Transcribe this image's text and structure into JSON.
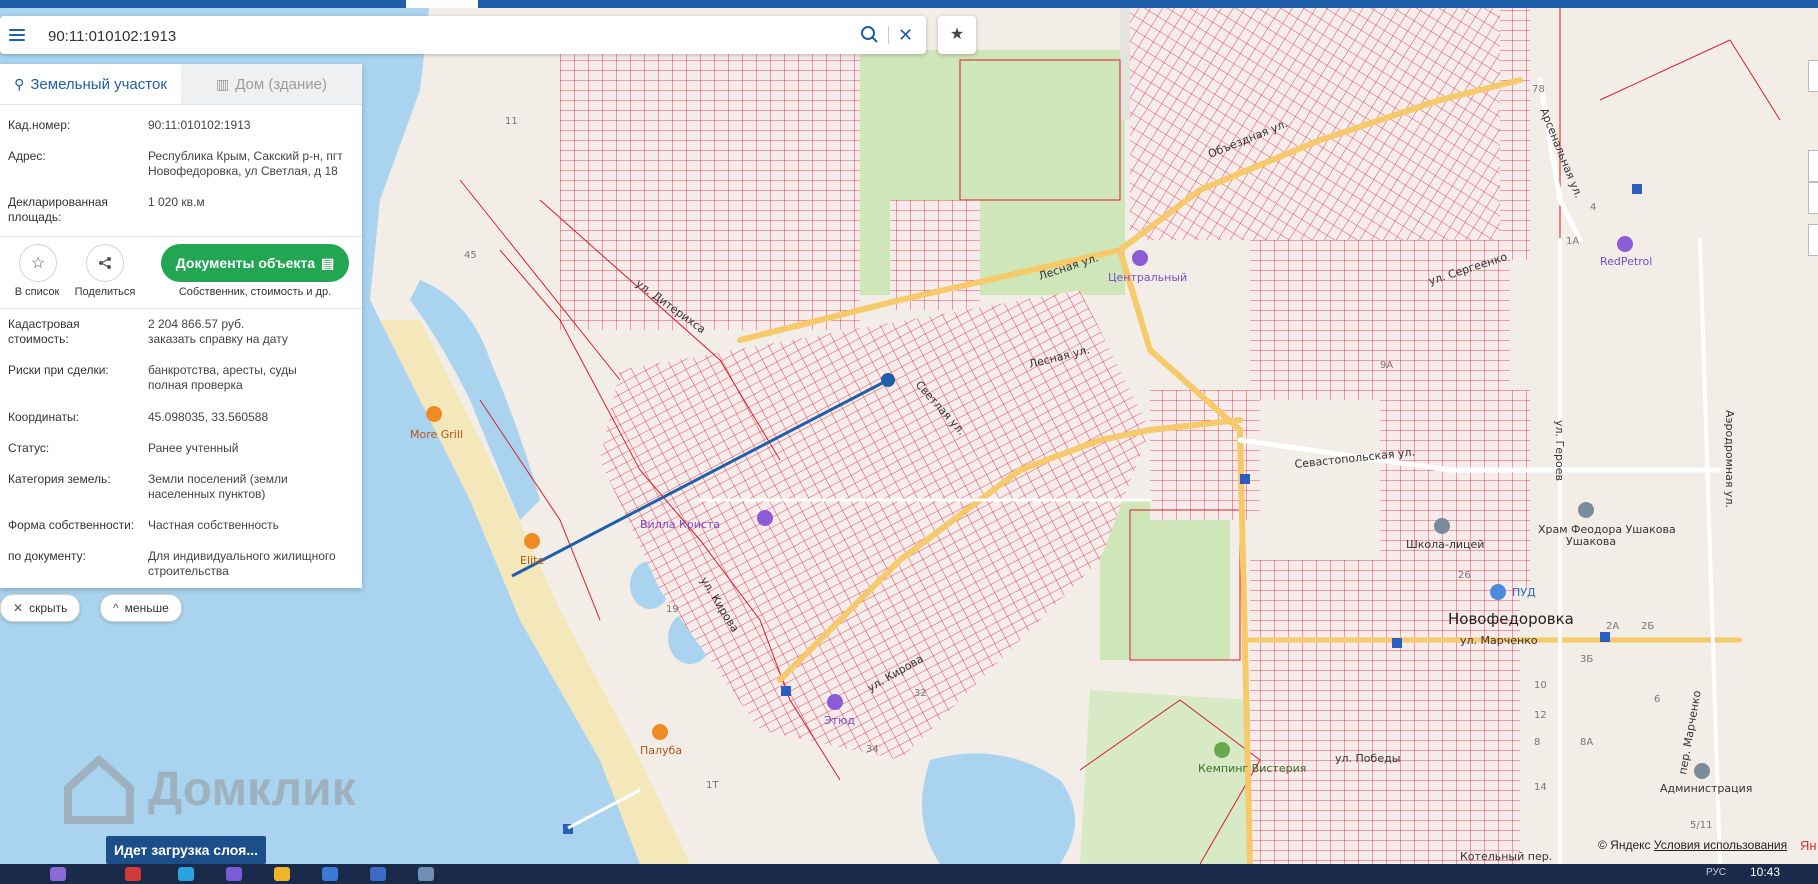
{
  "search": {
    "value": "90:11:010102:1913"
  },
  "tabs": [
    {
      "label": "Земельный участок",
      "icon": "map-pin-icon",
      "active": true
    },
    {
      "label": "Дом (здание)",
      "icon": "building-icon",
      "active": false
    }
  ],
  "details": {
    "cadastral_label": "Кад.номер:",
    "cadastral_value": "90:11:010102:1913",
    "address_label": "Адрес:",
    "address_value": "Республика Крым, Сакский р-н, пгт Новофедоровка, ул Светлая, д 18",
    "area_label": "Декларированная площадь:",
    "area_value": "1 020 кв.м"
  },
  "actions": {
    "list_label": "В список",
    "share_label": "Поделиться",
    "docs_label": "Документы объекта",
    "docs_sub": "Собственник, стоимость и др."
  },
  "info": {
    "cost_label": "Кадастровая стоимость:",
    "cost_value": "2 204 866.57 руб.",
    "cost_link": "заказать справку на дату",
    "risks_label": "Риски при сделки:",
    "risks_value": "банкротства, аресты, суды",
    "risks_link": "полная проверка",
    "coords_label": "Координаты:",
    "coords_value": "45.098035, 33.560588",
    "status_label": "Статус:",
    "status_value": "Ранее учтенный",
    "category_label": "Категория земель:",
    "category_value": "Земли поселений (земли населенных пунктов)",
    "ownership_label": "Форма собственности:",
    "ownership_value": "Частная собственность",
    "doc_label": "по документу:",
    "doc_value": "Для индивидуального жилищного строительства"
  },
  "controls": {
    "hide_label": "скрыть",
    "less_label": "меньше"
  },
  "loading_text": "Идет загрузка слоя...",
  "watermark": "Домклик",
  "copyright": {
    "text": "© Яндекс",
    "link": "Условия использования",
    "brand": "Ян"
  },
  "taskbar": {
    "time": "10:43",
    "lang": "РУС"
  },
  "map": {
    "streets": [
      "ул. Дитерихса",
      "ул. Кирова",
      "Лесная ул.",
      "Объездная ул.",
      "Арсенальная ул.",
      "Севастопольская ул.",
      "ул. Сергеенко",
      "ул. Героев",
      "ул. Марченко",
      "Аэродромная ул.",
      "ул. Кирова",
      "Светлая ул.",
      "пер. Марченко",
      "Котельный пер.",
      "ул. Победы",
      "Лесная ул."
    ],
    "pois": [
      "More Grill",
      "Elite",
      "Палуба",
      "Вилла Криста",
      "Этюд",
      "Центральный",
      "RedPetrol",
      "Школа-лицей",
      "Храм Феодора Ушакова",
      "ПУД",
      "Кемпинг Вистерия",
      "Администрация",
      "Новофедоровка"
    ],
    "numbers": [
      "45",
      "11",
      "19",
      "34",
      "32",
      "26",
      "78",
      "4",
      "1А",
      "2А",
      "2Б",
      "3Б",
      "6",
      "8",
      "8А",
      "9А",
      "10",
      "12",
      "14",
      "1Т",
      "5/11",
      "9А",
      "1Б",
      "1В"
    ],
    "colors": {
      "water": "#a9d3ef",
      "parcel": "#d81c2a",
      "park": "#cfe6b8",
      "road": "#f6c96b",
      "land": "#f2eee7"
    }
  }
}
